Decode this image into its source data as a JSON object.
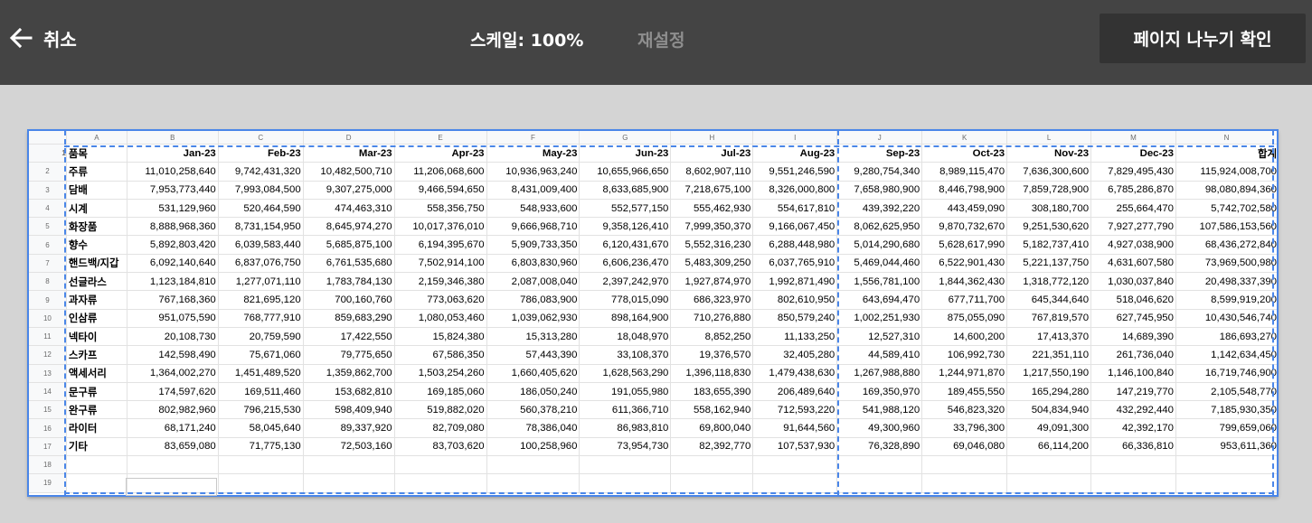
{
  "toolbar": {
    "cancel_label": "취소",
    "scale_label": "스케일: 100%",
    "reset_label": "재설정",
    "confirm_label": "페이지 나누기 확인"
  },
  "colors": {
    "toolbar_bg": "#444444",
    "confirm_bg": "#333333",
    "page_break": "#4a86e8",
    "reset_disabled": "#8e8e8e"
  },
  "sheet": {
    "columns": [
      "A",
      "B",
      "C",
      "D",
      "E",
      "F",
      "G",
      "H",
      "I",
      "J",
      "K",
      "L",
      "M",
      "N"
    ],
    "header": [
      "품목",
      "Jan-23",
      "Feb-23",
      "Mar-23",
      "Apr-23",
      "May-23",
      "Jun-23",
      "Jul-23",
      "Aug-23",
      "Sep-23",
      "Oct-23",
      "Nov-23",
      "Dec-23",
      "합계"
    ],
    "rows": [
      [
        "주류",
        "11,010,258,640",
        "9,742,431,320",
        "10,482,500,710",
        "11,206,068,600",
        "10,936,963,240",
        "10,655,966,650",
        "8,602,907,110",
        "9,551,246,590",
        "9,280,754,340",
        "8,989,115,470",
        "7,636,300,600",
        "7,829,495,430",
        "115,924,008,700"
      ],
      [
        "담배",
        "7,953,773,440",
        "7,993,084,500",
        "9,307,275,000",
        "9,466,594,650",
        "8,431,009,400",
        "8,633,685,900",
        "7,218,675,100",
        "8,326,000,800",
        "7,658,980,900",
        "8,446,798,900",
        "7,859,728,900",
        "6,785,286,870",
        "98,080,894,360"
      ],
      [
        "시계",
        "531,129,960",
        "520,464,590",
        "474,463,310",
        "558,356,750",
        "548,933,600",
        "552,577,150",
        "555,462,930",
        "554,617,810",
        "439,392,220",
        "443,459,090",
        "308,180,700",
        "255,664,470",
        "5,742,702,580"
      ],
      [
        "화장품",
        "8,888,968,360",
        "8,731,154,950",
        "8,645,974,270",
        "10,017,376,010",
        "9,666,968,710",
        "9,358,126,410",
        "7,999,350,370",
        "9,166,067,450",
        "8,062,625,950",
        "9,870,732,670",
        "9,251,530,620",
        "7,927,277,790",
        "107,586,153,560"
      ],
      [
        "향수",
        "5,892,803,420",
        "6,039,583,440",
        "5,685,875,100",
        "6,194,395,670",
        "5,909,733,350",
        "6,120,431,670",
        "5,552,316,230",
        "6,288,448,980",
        "5,014,290,680",
        "5,628,617,990",
        "5,182,737,410",
        "4,927,038,900",
        "68,436,272,840"
      ],
      [
        "핸드백/지갑",
        "6,092,140,640",
        "6,837,076,750",
        "6,761,535,680",
        "7,502,914,100",
        "6,803,830,960",
        "6,606,236,470",
        "5,483,309,250",
        "6,037,765,910",
        "5,469,044,460",
        "6,522,901,430",
        "5,221,137,750",
        "4,631,607,580",
        "73,969,500,980"
      ],
      [
        "선글라스",
        "1,123,184,810",
        "1,277,071,110",
        "1,783,784,130",
        "2,159,346,380",
        "2,087,008,040",
        "2,397,242,970",
        "1,927,874,970",
        "1,992,871,490",
        "1,556,781,100",
        "1,844,362,430",
        "1,318,772,120",
        "1,030,037,840",
        "20,498,337,390"
      ],
      [
        "과자류",
        "767,168,360",
        "821,695,120",
        "700,160,760",
        "773,063,620",
        "786,083,900",
        "778,015,090",
        "686,323,970",
        "802,610,950",
        "643,694,470",
        "677,711,700",
        "645,344,640",
        "518,046,620",
        "8,599,919,200"
      ],
      [
        "인삼류",
        "951,075,590",
        "768,777,910",
        "859,683,290",
        "1,080,053,460",
        "1,039,062,930",
        "898,164,900",
        "710,276,880",
        "850,579,240",
        "1,002,251,930",
        "875,055,090",
        "767,819,570",
        "627,745,950",
        "10,430,546,740"
      ],
      [
        "넥타이",
        "20,108,730",
        "20,759,590",
        "17,422,550",
        "15,824,380",
        "15,313,280",
        "18,048,970",
        "8,852,250",
        "11,133,250",
        "12,527,310",
        "14,600,200",
        "17,413,370",
        "14,689,390",
        "186,693,270"
      ],
      [
        "스카프",
        "142,598,490",
        "75,671,060",
        "79,775,650",
        "67,586,350",
        "57,443,390",
        "33,108,370",
        "19,376,570",
        "32,405,280",
        "44,589,410",
        "106,992,730",
        "221,351,110",
        "261,736,040",
        "1,142,634,450"
      ],
      [
        "액세서리",
        "1,364,002,270",
        "1,451,489,520",
        "1,359,862,700",
        "1,503,254,260",
        "1,660,405,620",
        "1,628,563,290",
        "1,396,118,830",
        "1,479,438,630",
        "1,267,988,880",
        "1,244,971,870",
        "1,217,550,190",
        "1,146,100,840",
        "16,719,746,900"
      ],
      [
        "문구류",
        "174,597,620",
        "169,511,460",
        "153,682,810",
        "169,185,060",
        "186,050,240",
        "191,055,980",
        "183,655,390",
        "206,489,640",
        "169,350,970",
        "189,455,550",
        "165,294,280",
        "147,219,770",
        "2,105,548,770"
      ],
      [
        "완구류",
        "802,982,960",
        "796,215,530",
        "598,409,940",
        "519,882,020",
        "560,378,210",
        "611,366,710",
        "558,162,940",
        "712,593,220",
        "541,988,120",
        "546,823,320",
        "504,834,940",
        "432,292,440",
        "7,185,930,350"
      ],
      [
        "라이터",
        "68,171,240",
        "58,045,640",
        "89,337,920",
        "82,709,080",
        "78,386,040",
        "86,983,810",
        "69,800,040",
        "91,644,560",
        "49,300,960",
        "33,796,300",
        "49,091,300",
        "42,392,170",
        "799,659,060"
      ],
      [
        "기타",
        "83,659,080",
        "71,775,130",
        "72,503,160",
        "83,703,620",
        "100,258,960",
        "73,954,730",
        "82,392,770",
        "107,537,930",
        "76,328,890",
        "69,046,080",
        "66,114,200",
        "66,336,810",
        "953,611,360"
      ]
    ]
  }
}
